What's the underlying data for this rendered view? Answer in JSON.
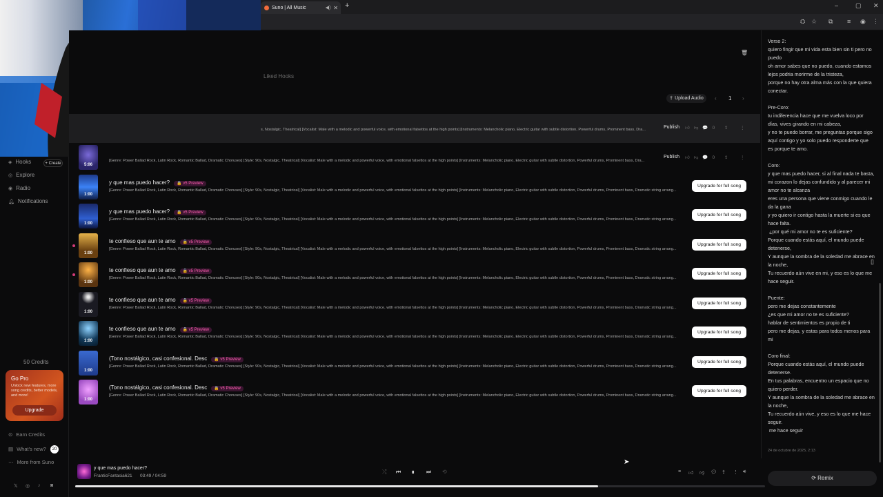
{
  "browser": {
    "tab_title": "Suno | All Music",
    "new_tab": "+",
    "window_controls": [
      "–",
      "▢",
      "✕"
    ]
  },
  "sidebar": {
    "items": [
      {
        "label": "Hooks",
        "icon": "hooks-icon"
      },
      {
        "label": "Explore",
        "icon": "explore-icon"
      },
      {
        "label": "Radio",
        "icon": "radio-icon"
      },
      {
        "label": "Notifications",
        "icon": "bell-icon"
      }
    ],
    "create_label": "+ Create",
    "credits": "50 Credits",
    "gopro": {
      "title": "Go Pro",
      "desc": "Unlock new features, more song credits, better models, and more!",
      "button": "Upgrade"
    },
    "footer": [
      {
        "label": "Earn Credits",
        "icon": "coin-icon"
      },
      {
        "label": "What's new?",
        "icon": "news-icon"
      },
      {
        "label": "More from Suno",
        "icon": "more-icon"
      }
    ],
    "news_count": "20",
    "social": [
      "𝕏",
      "◎",
      "♪",
      "◙"
    ]
  },
  "main": {
    "liked_hooks": "Liked Hooks",
    "upload_label": "⇪ Upload Audio",
    "page_number": "1",
    "publish_label": "Publish",
    "badge_label": "🔒 v5 Preview",
    "upgrade_label": "Upgrade for full song",
    "rows": [
      {
        "title": "",
        "desc": "s, Nostalgic, Theatrical] [Vocalist: Male with a melodic and powerful voice, with emotional falsettos at the high points] [Instruments: Melancholic piano, Electric guitar with subtle distortion, Powerful drums, Prominent bass, Dra...",
        "duration": "",
        "publish": true
      },
      {
        "title": "",
        "desc": "[Genre: Power Ballad Rock, Latin Rock, Romantic Ballad, Dramatic Choruses] [Style: 90s, Nostalgic, Theatrical] [Vocalist: Male with a melodic and powerful voice, with emotional falsettos at the high points] [Instruments: Melancholic piano, Electric guitar with subtle distortion, Powerful drums, Prominent bass, Dra...",
        "duration": "5:06",
        "publish": true
      },
      {
        "title": "y que mas puedo hacer?",
        "desc": "[Genre: Power Ballad Rock, Latin Rock, Romantic Ballad, Dramatic Choruses] [Style: 90s, Nostalgic, Theatrical] [Vocalist: Male with a melodic and powerful voice, with emotional falsettos at the high points] [Instruments: Melancholic piano, Electric guitar with subtle distortion, Powerful drums, Prominent bass, Dramatic string arrang...",
        "duration": "1:00",
        "publish": false
      },
      {
        "title": "y que mas puedo hacer?",
        "desc": "[Genre: Power Ballad Rock, Latin Rock, Romantic Ballad, Dramatic Choruses] [Style: 90s, Nostalgic, Theatrical] [Vocalist: Male with a melodic and powerful voice, with emotional falsettos at the high points] [Instruments: Melancholic piano, Electric guitar with subtle distortion, Powerful drums, Prominent bass, Dramatic string arrang...",
        "duration": "1:00",
        "publish": false
      },
      {
        "title": "te confieso que aun te amo",
        "desc": "[Genre: Power Ballad Rock, Latin Rock, Romantic Ballad, Dramatic Choruses] [Style: 90s, Nostalgic, Theatrical] [Vocalist: Male with a melodic and powerful voice, with emotional falsettos at the high points] [Instruments: Melancholic piano, Electric guitar with subtle distortion, Powerful drums, Prominent bass, Dramatic string arrang...",
        "duration": "1:00",
        "publish": false
      },
      {
        "title": "te confieso que aun te amo",
        "desc": "[Genre: Power Ballad Rock, Latin Rock, Romantic Ballad, Dramatic Choruses] [Style: 90s, Nostalgic, Theatrical] [Vocalist: Male with a melodic and powerful voice, with emotional falsettos at the high points] [Instruments: Melancholic piano, Electric guitar with subtle distortion, Powerful drums, Prominent bass, Dramatic string arrang...",
        "duration": "1:00",
        "publish": false
      },
      {
        "title": "te confieso que aun te amo",
        "desc": "[Genre: Power Ballad Rock, Latin Rock, Romantic Ballad, Dramatic Choruses] [Style: 90s, Nostalgic, Theatrical] [Vocalist: Male with a melodic and powerful voice, with emotional falsettos at the high points] [Instruments: Melancholic piano, Electric guitar with subtle distortion, Powerful drums, Prominent bass, Dramatic string arrang...",
        "duration": "1:00",
        "publish": false
      },
      {
        "title": "te confieso que aun te amo",
        "desc": "[Genre: Power Ballad Rock, Latin Rock, Romantic Ballad, Dramatic Choruses] [Style: 90s, Nostalgic, Theatrical] [Vocalist: Male with a melodic and powerful voice, with emotional falsettos at the high points] [Instruments: Melancholic piano, Electric guitar with subtle distortion, Powerful drums, Prominent bass, Dramatic string arrang...",
        "duration": "1:00",
        "publish": false
      },
      {
        "title": "(Tono nostálgico, casi confesional. Desc",
        "desc": "[Genre: Power Ballad Rock, Latin Rock, Romantic Ballad, Dramatic Choruses] [Style: 90s, Nostalgic, Theatrical] [Vocalist: Male with a melodic and powerful voice, with emotional falsettos at the high points] [Instruments: Melancholic piano, Electric guitar with subtle distortion, Powerful drums, Prominent bass, Dramatic string arrang...",
        "duration": "1:00",
        "publish": false
      },
      {
        "title": "(Tono nostálgico, casi confesional. Desc",
        "desc": "[Genre: Power Ballad Rock, Latin Rock, Romantic Ballad, Dramatic Choruses] [Style: 90s, Nostalgic, Theatrical] [Vocalist: Male with a melodic and powerful voice, with emotional falsettos at the high points] [Instruments: Melancholic piano, Electric guitar with subtle distortion, Powerful drums, Prominent bass, Dramatic string arrang...",
        "duration": "1:00",
        "publish": false
      }
    ]
  },
  "lyrics": {
    "text": "Verso 2:\nquiero fingir que mi vida esta bien sin ti pero no puedo\noh amor sabes que no puedo, cuando estamos lejos podria morirme de la tristeza,\nporque no hay otra alma más con la que quiera conectar.\n\nPre-Coro:\ntu indiferencia hace que me vuelva loco por días, vives girando en mi cabeza,\ny no te puedo borrar, me preguntas porque sigo aquí contigo y yo solo puedo responderte que es porque te amo.\n\nCoro:\ny que mas puedo hacer, si al final nada te basta,\nmi corazon lo dejas confundido y al parecer mi amor no te alcanza\neres una persona que viene conmigo cuando le da la gana\ny yo quiero ir contigo hasta la muerte si es que hace falta.\n ¿por qué mi amor no te es suficiente?\nPorque cuando estás aquí, el mundo puede detenerse,\nY aunque la sombra de la soledad me abrace en la noche,\nTu recuerdo aún vive en mi, y eso es lo que me hace seguir.\n\nPuente:\npero me dejas constantemente\n¿es que mi amor no te es suficiente?\nhablar de sentimientos es propio de ti\npero me dejas, y estas para todos menos para mi\n\nCoro final:\nPorque cuando estás aquí, el mundo puede detenerse.\nEn tus palabras, encuentro un espacio que no quiero perder.\nY aunque la sombra de la soledad me abrace en la noche,\nTu recuerdo aún vive, y eso es lo que me hace seguir.\n me hace seguir",
    "date": "24 de octubre de 2025, 2:13",
    "remix_label": "⟳ Remix"
  },
  "player": {
    "title": "y que mas puedo hacer?",
    "artist": "FranticFantasia621",
    "time": "03:49 /  04:59",
    "progress_fraction": 0.758
  },
  "colors": {
    "accent_pink": "#ff5fb0",
    "gopro": "#c8461e",
    "progress": "#e9e9e9"
  }
}
